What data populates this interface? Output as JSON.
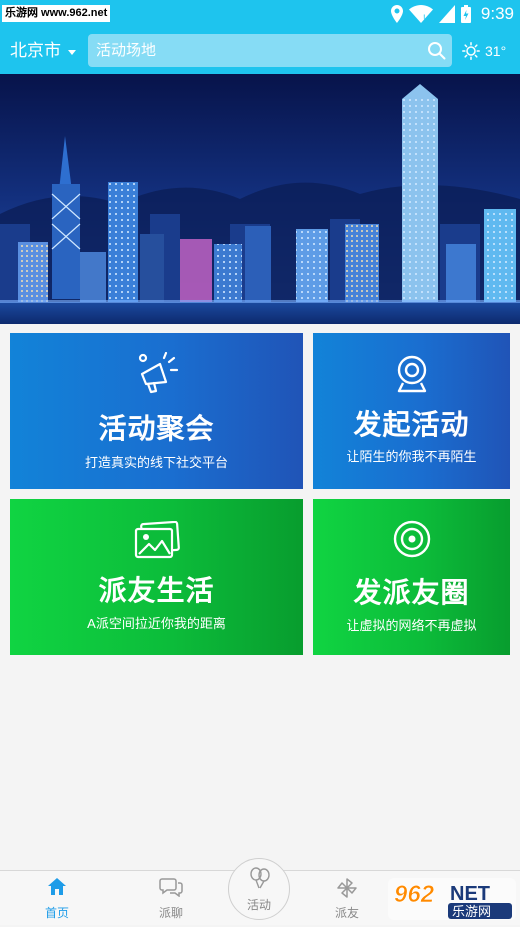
{
  "status_bar": {
    "watermark": "乐游网 www.962.net",
    "time": "9:39"
  },
  "header": {
    "city": "北京市",
    "search_placeholder": "活动场地",
    "weather_temp": "31°"
  },
  "cards": [
    {
      "title": "活动聚会",
      "subtitle": "打造真实的线下社交平台",
      "icon": "megaphone-icon"
    },
    {
      "title": "发起活动",
      "subtitle": "让陌生的你我不再陌生",
      "icon": "webcam-icon"
    },
    {
      "title": "派友生活",
      "subtitle": "A派空间拉近你我的距离",
      "icon": "photo-icon"
    },
    {
      "title": "发派友圈",
      "subtitle": "让虚拟的网络不再虚拟",
      "icon": "circle-target-icon"
    }
  ],
  "bottom_nav": {
    "items": [
      {
        "label": "首页",
        "active": true
      },
      {
        "label": "派聊",
        "active": false
      },
      {
        "label": "活动",
        "active": false
      },
      {
        "label": "派友",
        "active": false
      }
    ]
  },
  "watermark_logo": {
    "number": "962",
    "suffix": "NET",
    "name": "乐游网"
  },
  "colors": {
    "primary": "#1ec4ee",
    "card_blue": "#1a6ed0",
    "card_green": "#0cbc3a",
    "nav_active": "#1e9ce8"
  }
}
